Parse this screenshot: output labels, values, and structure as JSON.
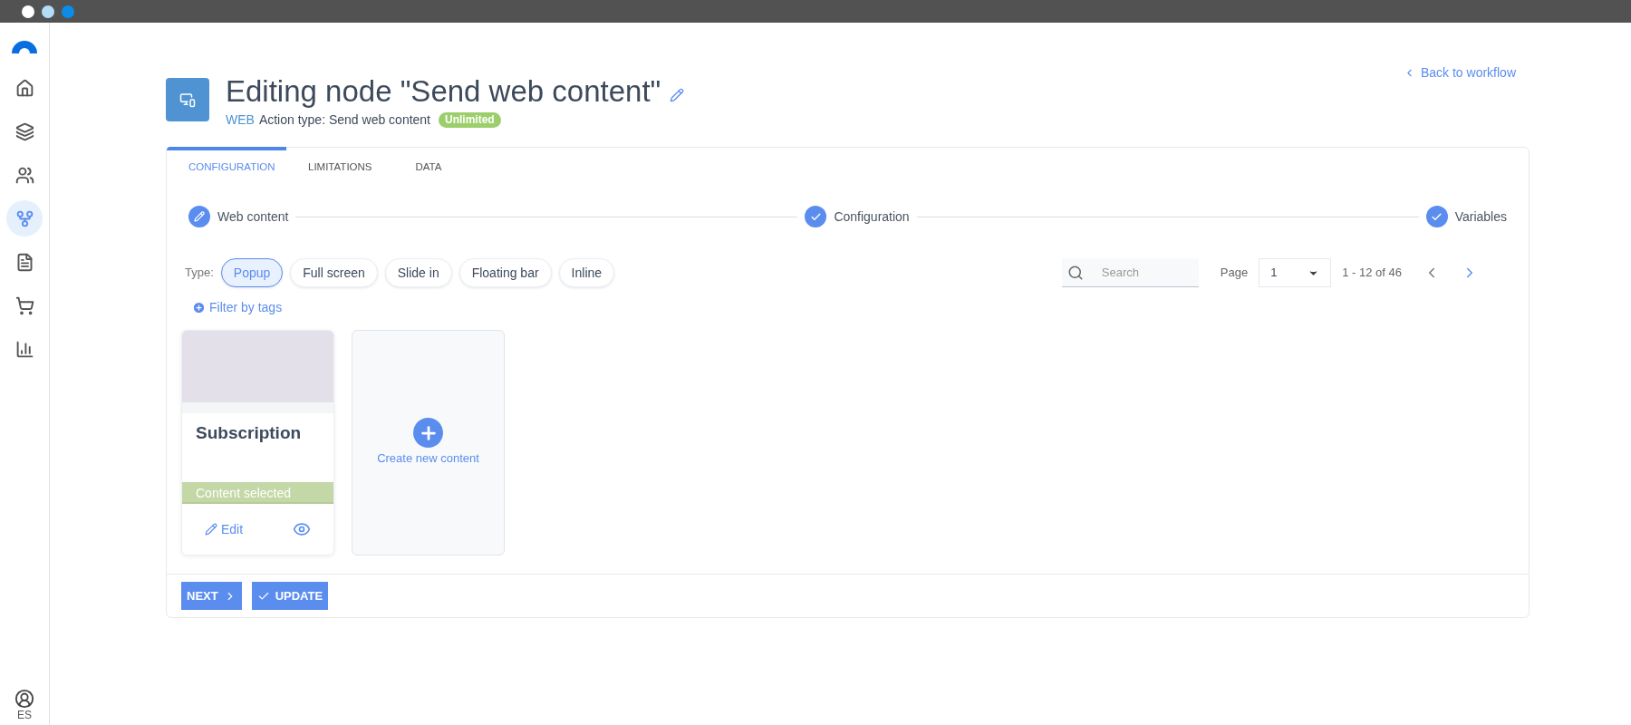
{
  "window_controls": [
    {
      "color": "#ffffff"
    },
    {
      "color": "#b3dcf7"
    },
    {
      "color": "#0a8de8"
    }
  ],
  "sidebar": {
    "items": [
      {
        "kind": "home",
        "selected": false
      },
      {
        "kind": "layers",
        "selected": false
      },
      {
        "kind": "users",
        "selected": false
      },
      {
        "kind": "workflow",
        "selected": true
      },
      {
        "kind": "document",
        "selected": false
      },
      {
        "kind": "cart",
        "selected": false
      },
      {
        "kind": "chart",
        "selected": false
      }
    ],
    "user": "ES"
  },
  "header": {
    "title": "Editing node \"Send web content\"",
    "channel": "WEB",
    "action_type": "Action type: Send web content",
    "badge": "Unlimited",
    "back_link": "Back to workflow"
  },
  "tabs": [
    {
      "label": "CONFIGURATION",
      "selected": true
    },
    {
      "label": "LIMITATIONS",
      "selected": false
    },
    {
      "label": "DATA",
      "selected": false
    }
  ],
  "steps": [
    {
      "label": "Web content",
      "kind": "edit"
    },
    {
      "label": "Configuration",
      "kind": "done"
    },
    {
      "label": "Variables",
      "kind": "done"
    }
  ],
  "type_filter": {
    "label": "Type:",
    "options": [
      {
        "label": "Popup",
        "selected": true
      },
      {
        "label": "Full screen",
        "selected": false
      },
      {
        "label": "Slide in",
        "selected": false
      },
      {
        "label": "Floating bar",
        "selected": false
      },
      {
        "label": "Inline",
        "selected": false
      }
    ]
  },
  "filter_by_tags": "Filter by tags",
  "search": {
    "placeholder": "Search"
  },
  "pagination": {
    "label": "Page",
    "value": "1",
    "range": "1 - 12 of 46"
  },
  "contents": [
    {
      "title": "Subscription",
      "status": "Content selected",
      "selected": true,
      "edit": "Edit"
    }
  ],
  "create_new": "Create new content",
  "buttons": [
    {
      "label": "NEXT",
      "kind": "next"
    },
    {
      "label": "UPDATE",
      "kind": "update"
    }
  ]
}
